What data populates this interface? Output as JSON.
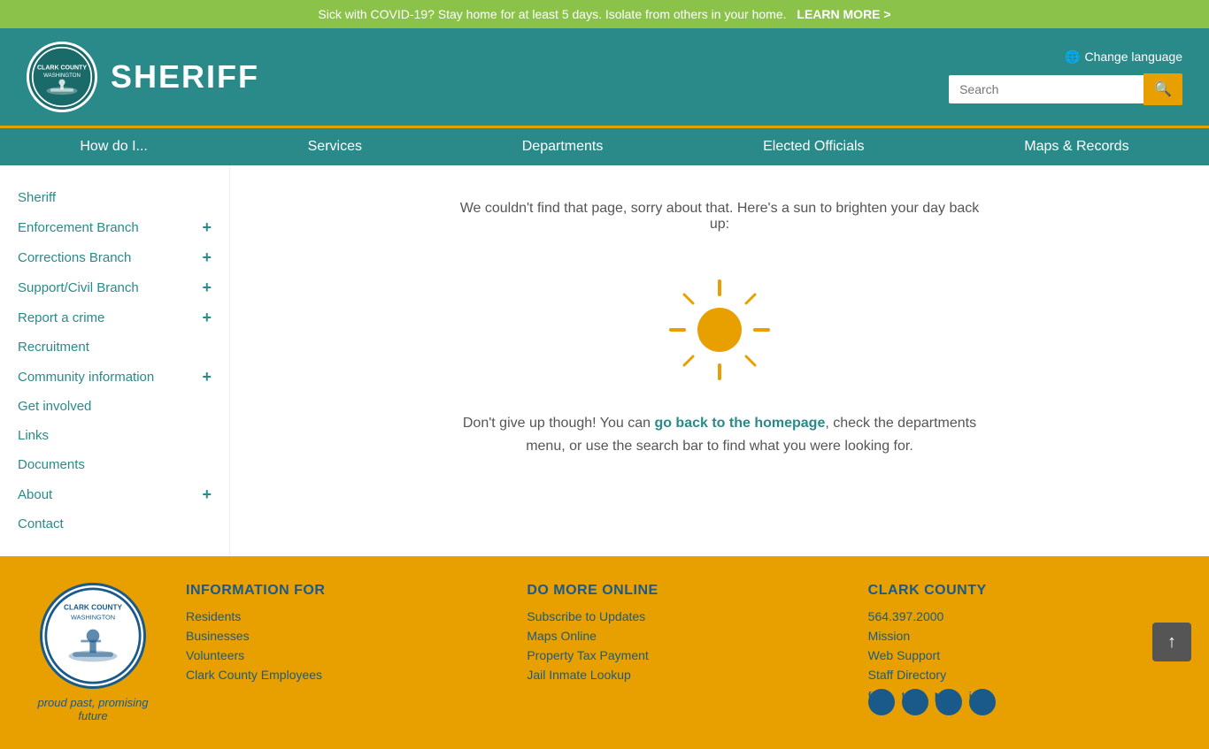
{
  "covid_banner": {
    "message": "Sick with COVID-19? Stay home for at least 5 days. Isolate from others in your home.",
    "link_text": "LEARN MORE >"
  },
  "header": {
    "title": "SHERIFF",
    "language_link": "Change language",
    "search_placeholder": "Search"
  },
  "nav": {
    "items": [
      {
        "label": "How do I...",
        "id": "how-do-i"
      },
      {
        "label": "Services",
        "id": "services"
      },
      {
        "label": "Departments",
        "id": "departments"
      },
      {
        "label": "Elected Officials",
        "id": "elected-officials"
      },
      {
        "label": "Maps & Records",
        "id": "maps-records"
      }
    ]
  },
  "sidebar": {
    "items": [
      {
        "label": "Sheriff",
        "expandable": false
      },
      {
        "label": "Enforcement Branch",
        "expandable": true
      },
      {
        "label": "Corrections Branch",
        "expandable": true
      },
      {
        "label": "Support/Civil Branch",
        "expandable": true
      },
      {
        "label": "Report a crime",
        "expandable": true
      },
      {
        "label": "Recruitment",
        "expandable": false
      },
      {
        "label": "Community information",
        "expandable": true
      },
      {
        "label": "Get involved",
        "expandable": false
      },
      {
        "label": "Links",
        "expandable": false
      },
      {
        "label": "Documents",
        "expandable": false
      },
      {
        "label": "About",
        "expandable": true
      },
      {
        "label": "Contact",
        "expandable": false
      }
    ]
  },
  "main": {
    "error_message": "We couldn't find that page, sorry about that. Here's a sun to brighten your day back up:",
    "redirect_part1": "Don't give up though! You can ",
    "redirect_link": "go back to the homepage",
    "redirect_part2": ", check the departments menu, or use the search bar to find what you were looking for."
  },
  "footer": {
    "logo_tagline": "proud past, promising future",
    "info_col": {
      "heading": "INFORMATION FOR",
      "links": [
        "Residents",
        "Businesses",
        "Volunteers",
        "Clark County Employees"
      ]
    },
    "online_col": {
      "heading": "DO MORE ONLINE",
      "links": [
        "Subscribe to Updates",
        "Maps Online",
        "Property Tax Payment",
        "Jail Inmate Lookup"
      ]
    },
    "clark_col": {
      "heading": "CLARK COUNTY",
      "phone": "564.397.2000",
      "links": [
        "Mission",
        "Web Support",
        "Staff Directory"
      ]
    }
  }
}
